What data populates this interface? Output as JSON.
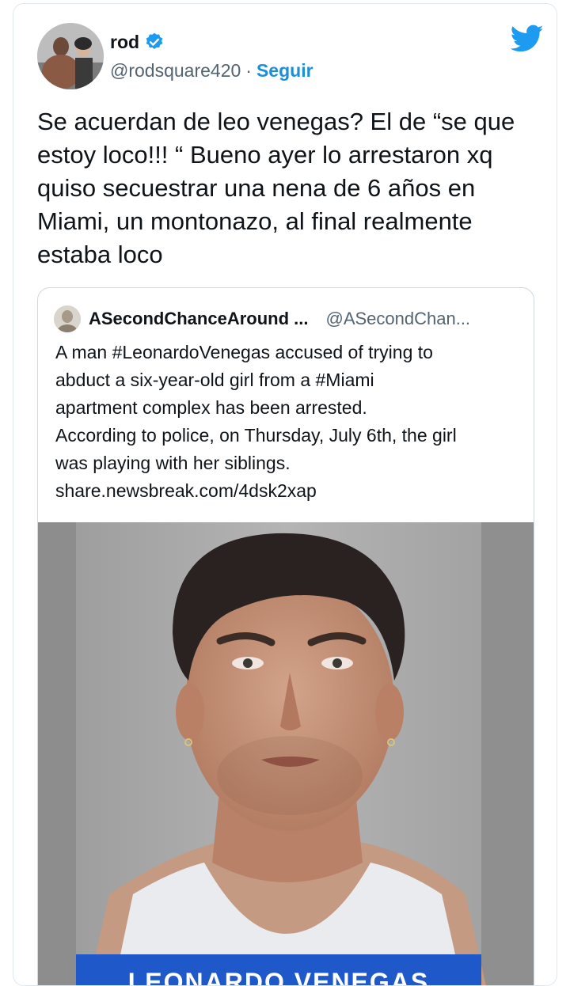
{
  "tweet": {
    "author_name": "rod",
    "author_handle": "@rodsquare420",
    "separator": "·",
    "follow_label": "Seguir",
    "text": "Se acuerdan de leo venegas? El de “se que estoy loco!!! “ Bueno ayer lo arrestaron xq quiso secuestrar una nena de 6 años en Miami, un montonazo, al final realmente estaba loco"
  },
  "quoted": {
    "author_name": "ASecondChanceAround ...",
    "author_handle": "@ASecondChan...",
    "text_lines": [
      "A man #LeonardoVenegas accused of trying to",
      "abduct a six-year-old girl from a #Miami",
      "apartment complex has been arrested.",
      "According to police, on Thursday, July 6th, the girl",
      "was playing with her siblings."
    ],
    "link": "share.newsbreak.com/4dsk2xap",
    "image_caption": "LEONARDO VENEGAS"
  },
  "icons": {
    "verified": "verified-badge-icon",
    "brand": "twitter-bird-icon"
  },
  "colors": {
    "link_blue": "#1d8fd8",
    "twitter_blue": "#1d9bf0",
    "secondary_text": "#536471",
    "border": "#cfd9de",
    "caption_bar": "#1f58c9"
  }
}
